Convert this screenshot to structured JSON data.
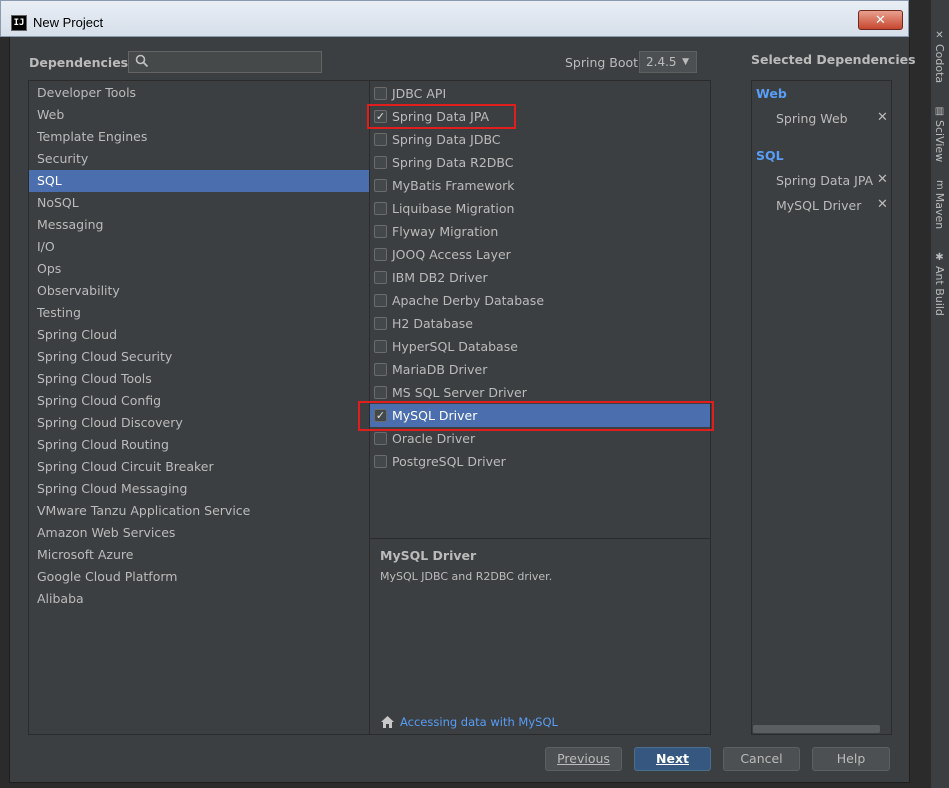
{
  "window": {
    "title": "New Project",
    "app_icon": "IJ",
    "close_glyph": "✕"
  },
  "header": {
    "dependencies_label": "Dependencies",
    "search_placeholder": "",
    "spring_boot_label": "Spring Boot",
    "spring_boot_version": "2.4.5"
  },
  "categories": [
    {
      "label": "Developer Tools",
      "selected": false
    },
    {
      "label": "Web",
      "selected": false
    },
    {
      "label": "Template Engines",
      "selected": false
    },
    {
      "label": "Security",
      "selected": false
    },
    {
      "label": "SQL",
      "selected": true
    },
    {
      "label": "NoSQL",
      "selected": false
    },
    {
      "label": "Messaging",
      "selected": false
    },
    {
      "label": "I/O",
      "selected": false
    },
    {
      "label": "Ops",
      "selected": false
    },
    {
      "label": "Observability",
      "selected": false
    },
    {
      "label": "Testing",
      "selected": false
    },
    {
      "label": "Spring Cloud",
      "selected": false
    },
    {
      "label": "Spring Cloud Security",
      "selected": false
    },
    {
      "label": "Spring Cloud Tools",
      "selected": false
    },
    {
      "label": "Spring Cloud Config",
      "selected": false
    },
    {
      "label": "Spring Cloud Discovery",
      "selected": false
    },
    {
      "label": "Spring Cloud Routing",
      "selected": false
    },
    {
      "label": "Spring Cloud Circuit Breaker",
      "selected": false
    },
    {
      "label": "Spring Cloud Messaging",
      "selected": false
    },
    {
      "label": "VMware Tanzu Application Service",
      "selected": false
    },
    {
      "label": "Amazon Web Services",
      "selected": false
    },
    {
      "label": "Microsoft Azure",
      "selected": false
    },
    {
      "label": "Google Cloud Platform",
      "selected": false
    },
    {
      "label": "Alibaba",
      "selected": false
    }
  ],
  "dependencies": [
    {
      "label": "JDBC API",
      "checked": false,
      "selected": false,
      "highlighted": false
    },
    {
      "label": "Spring Data JPA",
      "checked": true,
      "selected": false,
      "highlighted": true
    },
    {
      "label": "Spring Data JDBC",
      "checked": false,
      "selected": false,
      "highlighted": false
    },
    {
      "label": "Spring Data R2DBC",
      "checked": false,
      "selected": false,
      "highlighted": false
    },
    {
      "label": "MyBatis Framework",
      "checked": false,
      "selected": false,
      "highlighted": false
    },
    {
      "label": "Liquibase Migration",
      "checked": false,
      "selected": false,
      "highlighted": false
    },
    {
      "label": "Flyway Migration",
      "checked": false,
      "selected": false,
      "highlighted": false
    },
    {
      "label": "JOOQ Access Layer",
      "checked": false,
      "selected": false,
      "highlighted": false
    },
    {
      "label": "IBM DB2 Driver",
      "checked": false,
      "selected": false,
      "highlighted": false
    },
    {
      "label": "Apache Derby Database",
      "checked": false,
      "selected": false,
      "highlighted": false
    },
    {
      "label": "H2 Database",
      "checked": false,
      "selected": false,
      "highlighted": false
    },
    {
      "label": "HyperSQL Database",
      "checked": false,
      "selected": false,
      "highlighted": false
    },
    {
      "label": "MariaDB Driver",
      "checked": false,
      "selected": false,
      "highlighted": false
    },
    {
      "label": "MS SQL Server Driver",
      "checked": false,
      "selected": false,
      "highlighted": false
    },
    {
      "label": "MySQL Driver",
      "checked": true,
      "selected": true,
      "highlighted": true
    },
    {
      "label": "Oracle Driver",
      "checked": false,
      "selected": false,
      "highlighted": false
    },
    {
      "label": "PostgreSQL Driver",
      "checked": false,
      "selected": false,
      "highlighted": false
    }
  ],
  "description": {
    "title": "MySQL Driver",
    "text": "MySQL JDBC and R2DBC driver.",
    "guide_icon": "home-icon",
    "guide_link": "Accessing data with MySQL"
  },
  "selected_panel": {
    "title": "Selected Dependencies",
    "remove_glyph": "✕",
    "groups": [
      {
        "name": "Web",
        "items": [
          "Spring Web"
        ]
      },
      {
        "name": "SQL",
        "items": [
          "Spring Data JPA",
          "MySQL Driver"
        ]
      }
    ]
  },
  "buttons": {
    "previous": "Previous",
    "next": "Next",
    "cancel": "Cancel",
    "help": "Help"
  },
  "tool_strip": [
    {
      "label": "Codota",
      "icon": "codota-icon"
    },
    {
      "label": "SciView",
      "icon": "sciview-icon"
    },
    {
      "label": "Maven",
      "icon": "maven-icon"
    },
    {
      "label": "Ant Build",
      "icon": "ant-icon"
    }
  ],
  "colors": {
    "background": "#3c3f41",
    "selection": "#4b6eaf",
    "link": "#589df6",
    "highlight_border": "#e01e1e",
    "default_button": "#365880"
  }
}
